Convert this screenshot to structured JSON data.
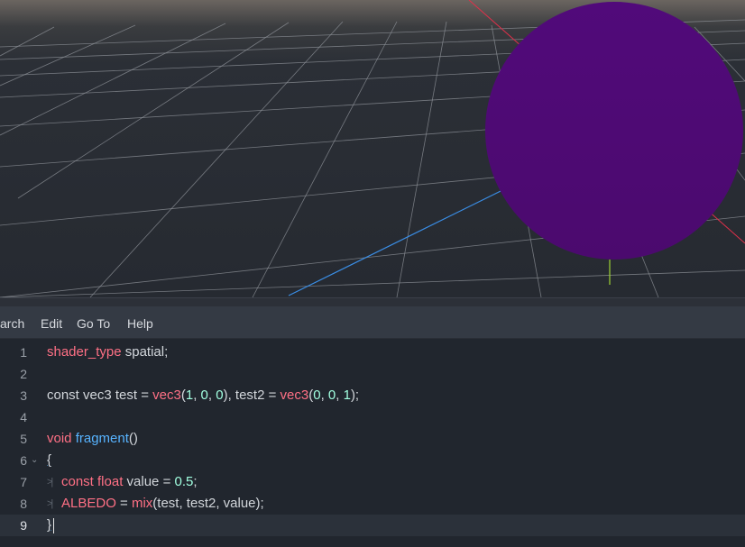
{
  "menu": {
    "search_label": "arch",
    "edit_label": "Edit",
    "goto_label": "Go To",
    "help_label": "Help"
  },
  "colors": {
    "sphere": "#4d0a73",
    "keyword": "#ff7085",
    "function": "#57b3ff",
    "number": "#a1ffe0",
    "x_axis": "#e0304a",
    "y_axis": "#9fd334",
    "z_axis": "#3a8ee6"
  },
  "editor": {
    "current_line": 9,
    "lines": [
      {
        "num": "1",
        "t": [
          "shader_type",
          " spatial;"
        ]
      },
      {
        "num": "2"
      },
      {
        "num": "3",
        "t": [
          "const vec3",
          " test = ",
          "vec3",
          "(",
          "1",
          ", ",
          "0",
          ", ",
          "0",
          "), test2 = ",
          "vec3",
          "(",
          "0",
          ", ",
          "0",
          ", ",
          "1",
          ");"
        ]
      },
      {
        "num": "4"
      },
      {
        "num": "5",
        "t": [
          "void",
          " ",
          "fragment",
          "()"
        ]
      },
      {
        "num": "6",
        "t": [
          "{"
        ]
      },
      {
        "num": "7",
        "t": [
          "const float",
          " value = ",
          "0.5",
          ";"
        ]
      },
      {
        "num": "8",
        "t": [
          "ALBEDO",
          " = ",
          "mix",
          "(test, test2, value);"
        ]
      },
      {
        "num": "9",
        "t": [
          "}"
        ]
      }
    ]
  }
}
